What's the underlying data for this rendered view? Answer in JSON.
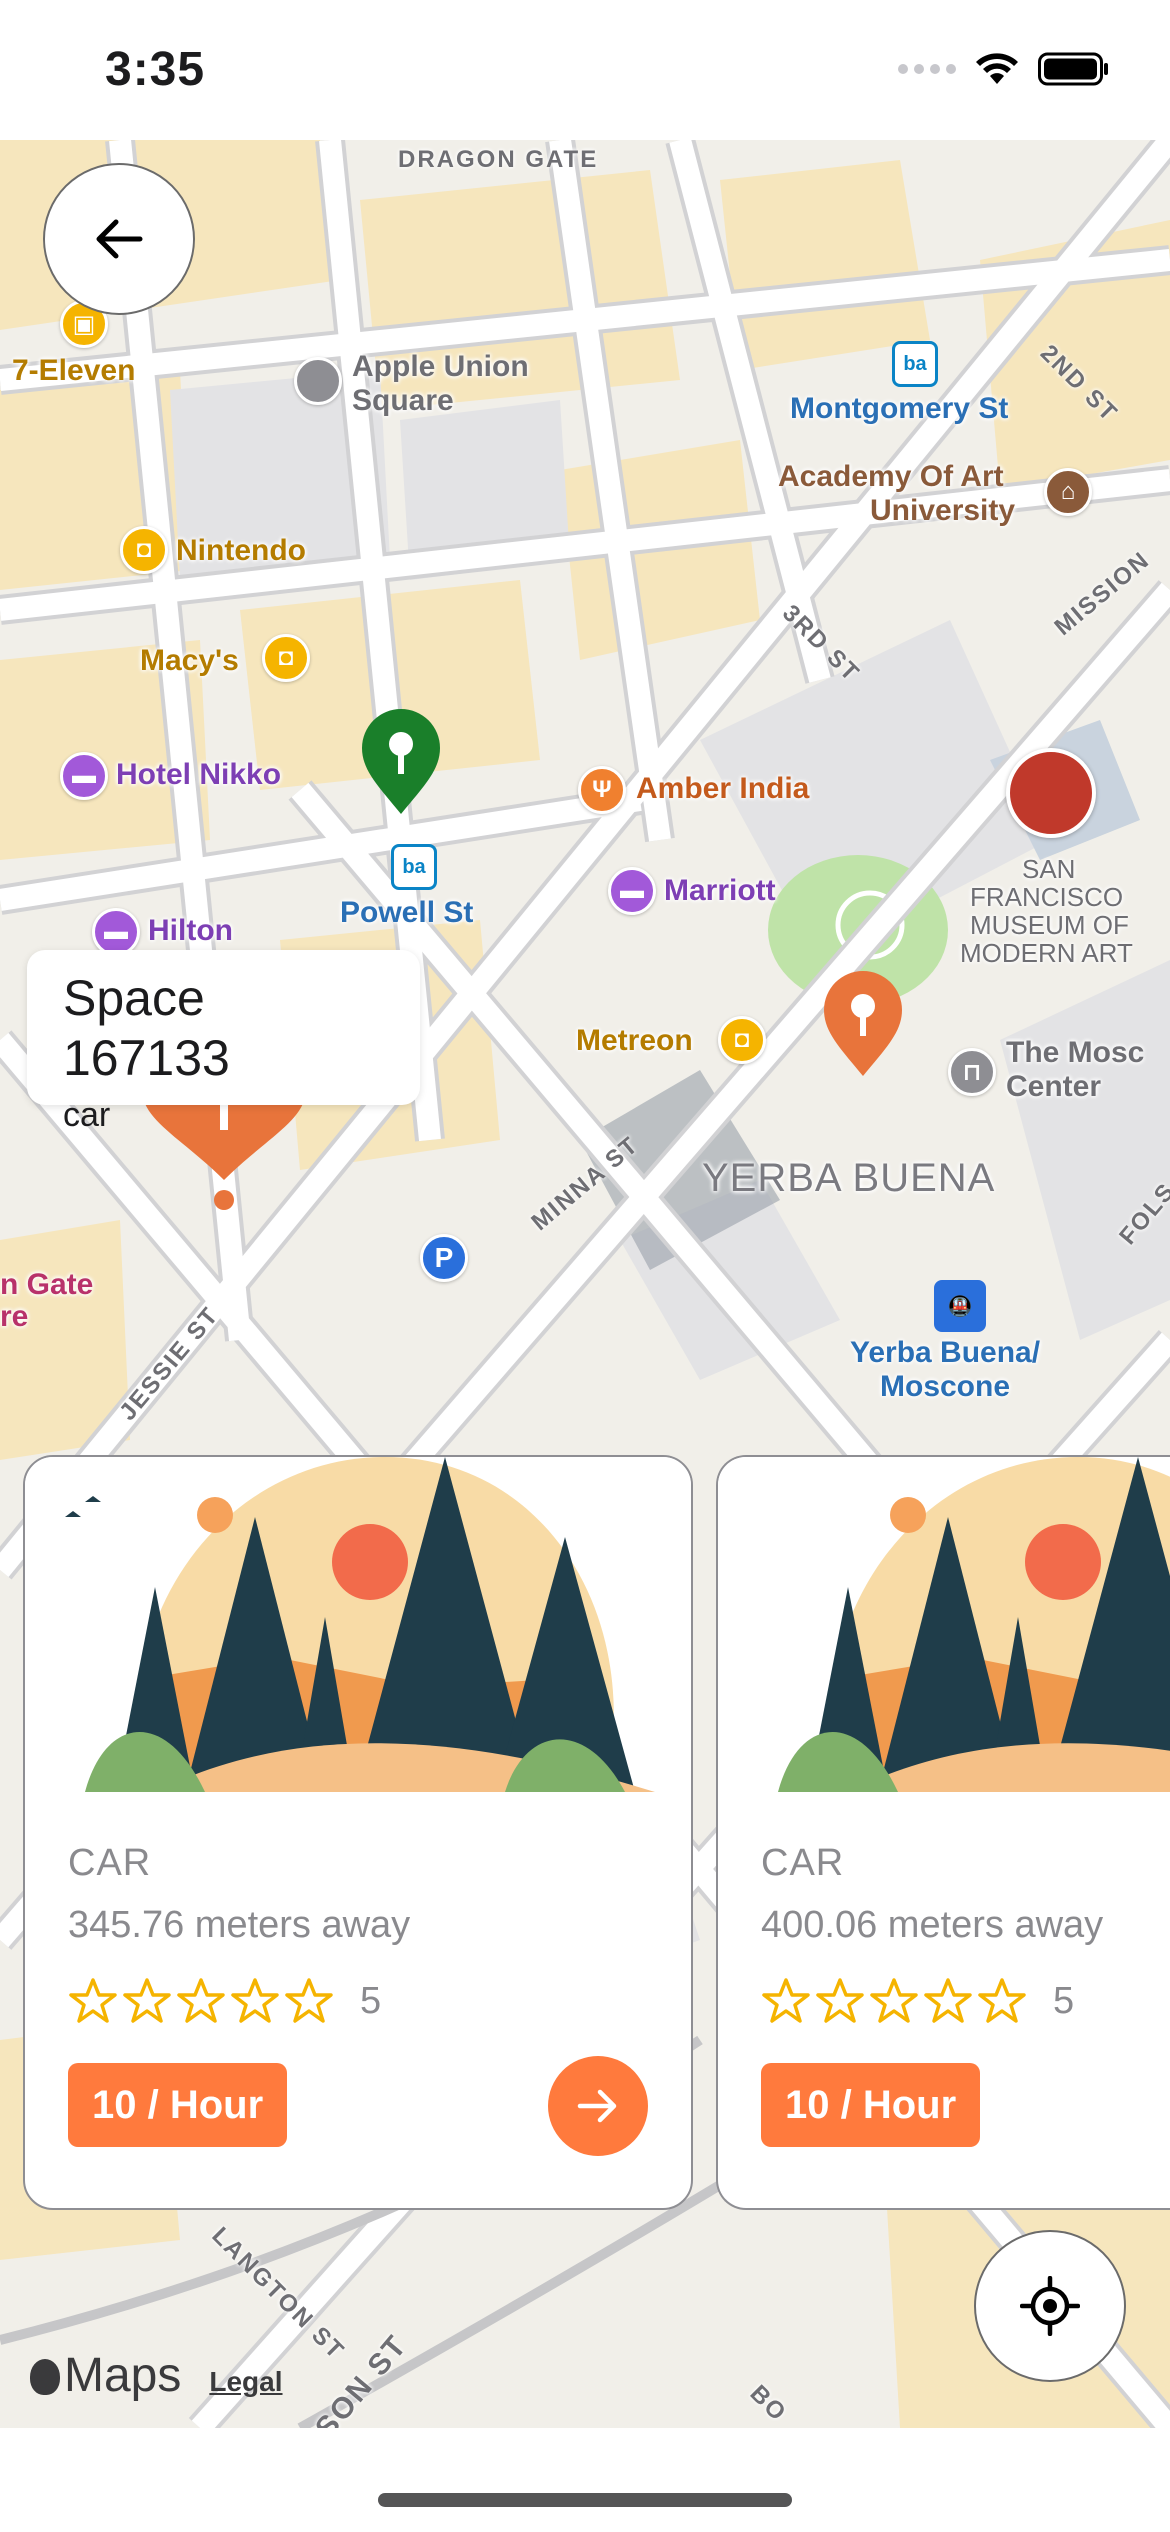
{
  "status_bar": {
    "time": "3:35"
  },
  "map": {
    "labels": {
      "dragon_gate": "DRAGON GATE",
      "seven_eleven": "7-Eleven",
      "apple_union_square": "Apple Union\nSquare",
      "apple_line1": "Apple Union",
      "apple_line2": "Square",
      "montgomery": "Montgomery St",
      "academy_line1": "Academy Of Art",
      "academy_line2": "University",
      "nintendo": "Nintendo",
      "macys": "Macy's",
      "hotel_nikko": "Hotel Nikko",
      "amber_india": "Amber India",
      "powell": "Powell St",
      "marriott": "Marriott",
      "hilton": "Hilton",
      "sfmoma_line1": "SAN",
      "sfmoma_line2": "FRANCISCO",
      "sfmoma_line3": "MUSEUM OF",
      "sfmoma_line4": "MODERN ART",
      "metreon": "Metreon",
      "moscone_line1": "The Mosc",
      "moscone_line2": "Center",
      "yerba_buena": "YERBA BUENA",
      "yb_station_line1": "Yerba Buena/",
      "yb_station_line2": "Moscone",
      "golden_gate_line1": "n Gate",
      "golden_gate_line2": "re",
      "parking": "P"
    },
    "streets": {
      "second": "2ND ST",
      "mission": "MISSION",
      "third": "3RD ST",
      "minna": "MINNA ST",
      "jessie": "JESSIE ST",
      "langton": "LANGTON ST",
      "folsom": "FOLS",
      "son": "SON ST",
      "bo": "BO"
    },
    "attribution": {
      "logo": "Maps",
      "legal": "Legal"
    }
  },
  "callout": {
    "title": "Space 167133",
    "subtitle": "car"
  },
  "cards": [
    {
      "type": "CAR",
      "distance": "345.76 meters away",
      "rating": "5",
      "stars": 5,
      "price": "10 / Hour"
    },
    {
      "type": "CAR",
      "distance": "400.06 meters away",
      "rating": "5",
      "stars": 5,
      "price": "10 / Hour"
    }
  ],
  "colors": {
    "accent": "#ff7a3d",
    "pin_green": "#1a7f2a",
    "pin_orange": "#e8743b",
    "transit_blue": "#0a84c6",
    "poi_purple": "#a259d9",
    "poi_yellow": "#f5b400"
  },
  "icons": {
    "back": "arrow-left-icon",
    "locate": "crosshair-icon",
    "go": "arrow-right-icon",
    "star": "star-outline-icon"
  }
}
